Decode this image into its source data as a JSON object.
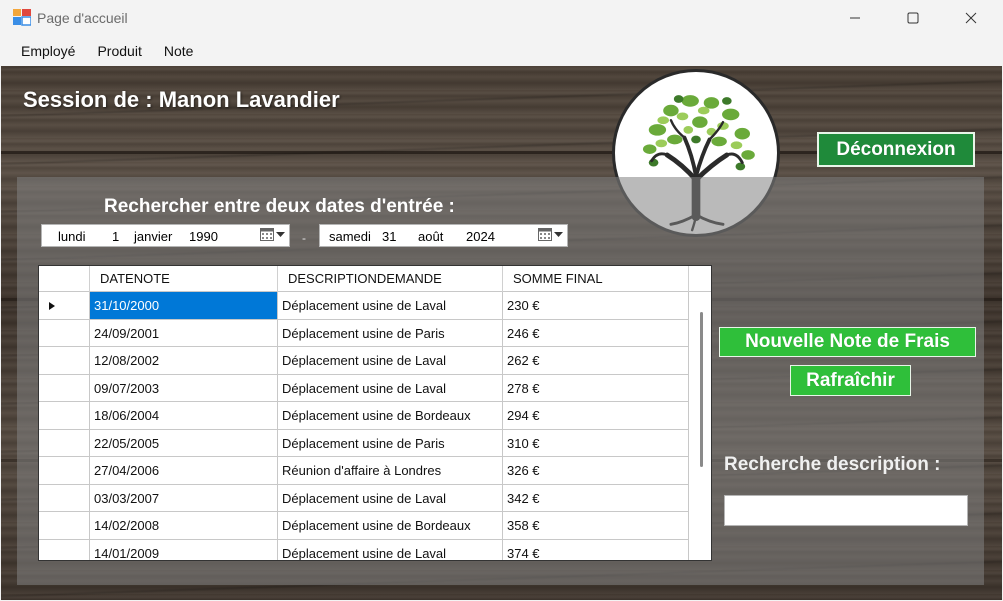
{
  "window": {
    "title": "Page d'accueil"
  },
  "menu": {
    "items": [
      "Employé",
      "Produit",
      "Note"
    ]
  },
  "session": {
    "title": "Session de : Manon Lavandier"
  },
  "buttons": {
    "logout": "Déconnexion",
    "new_note": "Nouvelle Note de Frais",
    "refresh": "Rafraîchir"
  },
  "date_search": {
    "label": "Rechercher entre deux dates d'entrée :",
    "from": {
      "weekday": "lundi",
      "day": "1",
      "month": "janvier",
      "year": "1990"
    },
    "to": {
      "weekday": "samedi",
      "day": "31",
      "month": "août",
      "year": "2024"
    }
  },
  "grid": {
    "columns": [
      "DATENOTE",
      "DESCRIPTIONDEMANDE",
      "SOMME FINAL"
    ],
    "rows": [
      [
        "31/10/2000",
        "Déplacement usine de Laval",
        "230 €"
      ],
      [
        "24/09/2001",
        "Déplacement usine de Paris",
        "246 €"
      ],
      [
        "12/08/2002",
        "Déplacement usine de Laval",
        "262 €"
      ],
      [
        "09/07/2003",
        "Déplacement usine de Laval",
        "278 €"
      ],
      [
        "18/06/2004",
        "Déplacement usine de Bordeaux",
        "294 €"
      ],
      [
        "22/05/2005",
        "Déplacement usine de Paris",
        "310 €"
      ],
      [
        "27/04/2006",
        "Réunion d'affaire à Londres",
        "326 €"
      ],
      [
        "03/03/2007",
        "Déplacement usine de Laval",
        "342 €"
      ],
      [
        "14/02/2008",
        "Déplacement usine de Bordeaux",
        "358 €"
      ],
      [
        "14/01/2009",
        "Déplacement usine de Laval",
        "374 €"
      ]
    ]
  },
  "description_search": {
    "label": "Recherche description :",
    "value": ""
  },
  "colors": {
    "accent_green": "#2fbf3a",
    "dark_green": "#1f8a3a",
    "selection": "#0078d7"
  }
}
